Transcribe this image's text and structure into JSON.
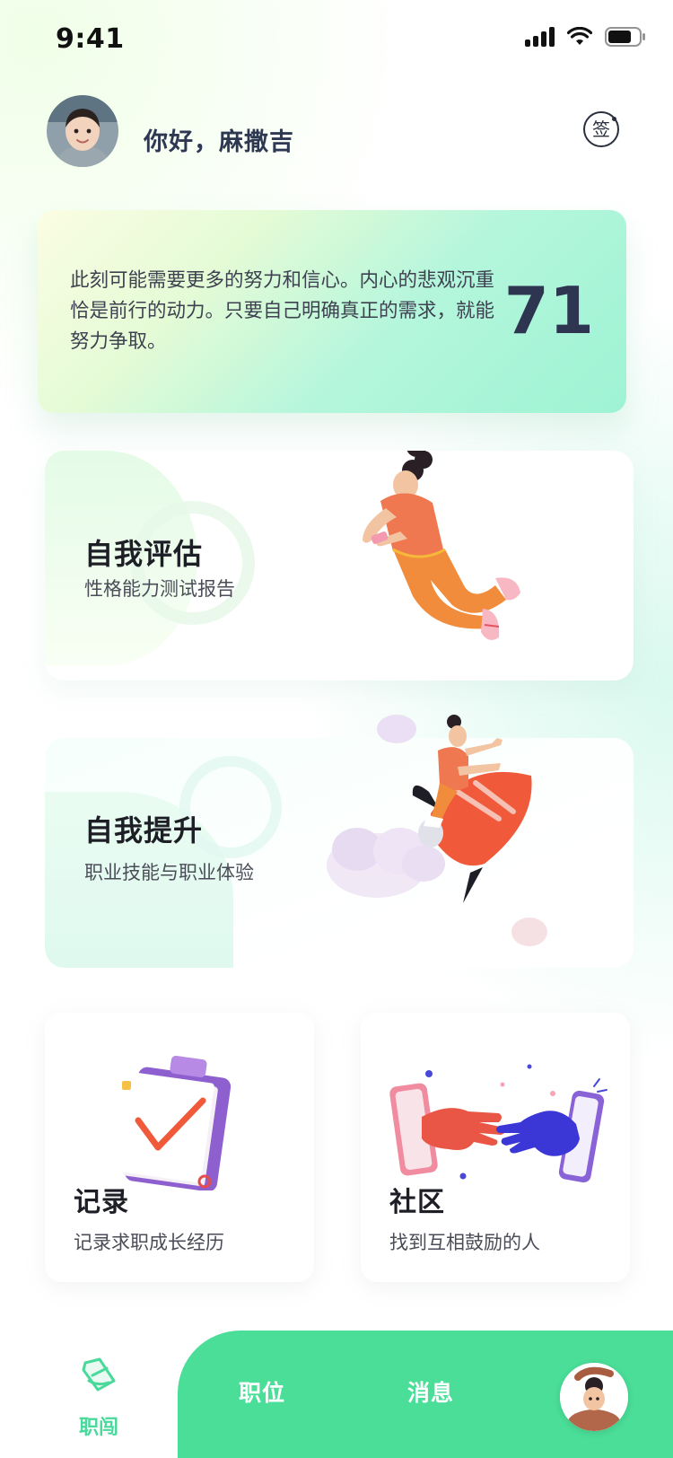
{
  "status_bar": {
    "time": "9:41"
  },
  "header": {
    "greeting": "你好，麻撒吉",
    "sign_label": "签"
  },
  "mood_card": {
    "text": "此刻可能需要更多的努力和信心。内心的悲观沉重恰是前行的动力。只要自己明确真正的需求，就能努力争取。",
    "score": "71"
  },
  "features": {
    "assess": {
      "title": "自我评估",
      "subtitle": "性格能力测试报告"
    },
    "improve": {
      "title": "自我提升",
      "subtitle": "职业技能与职业体验"
    },
    "record": {
      "title": "记录",
      "subtitle": "记录求职成长经历"
    },
    "community": {
      "title": "社区",
      "subtitle": "找到互相鼓励的人"
    }
  },
  "tab_bar": {
    "home_label": "职闯",
    "jobs_label": "职位",
    "messages_label": "消息"
  },
  "colors": {
    "accent_green": "#4ade98",
    "score_text": "#2e3550"
  },
  "icons": {
    "home_tab": "ticket-tag-icon",
    "sign_in": "sign-in-icon"
  }
}
